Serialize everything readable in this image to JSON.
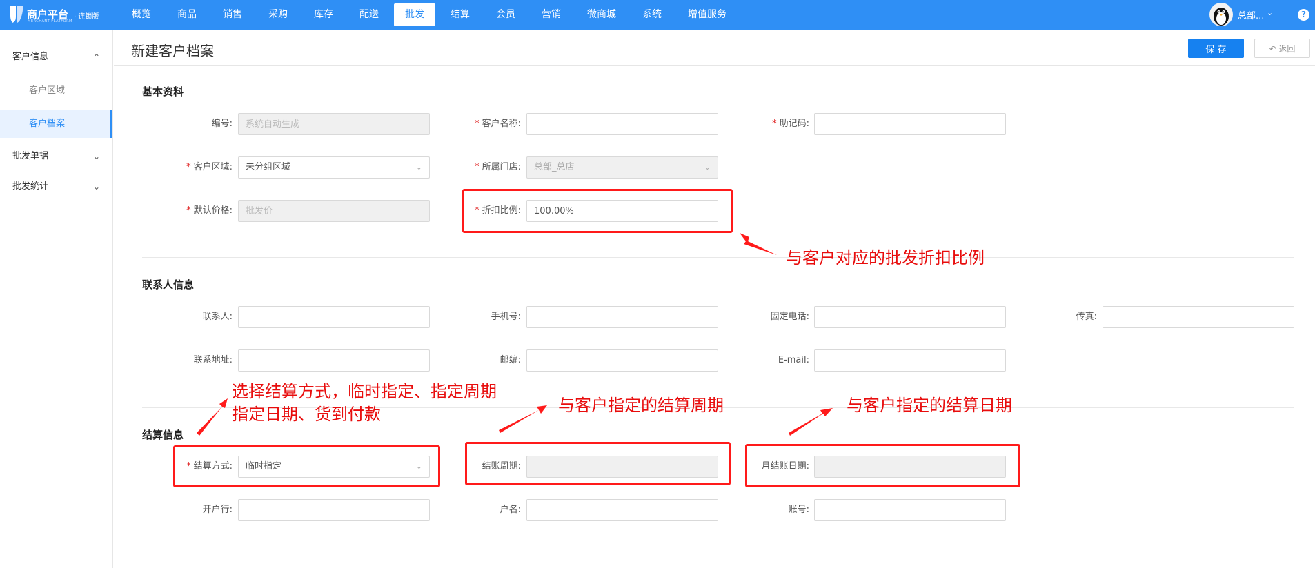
{
  "brand": {
    "title": "商户平台",
    "edition": "· 连锁版",
    "subtitle": "MERCHANT PLATFORM"
  },
  "nav": {
    "items": [
      "概览",
      "商品",
      "销售",
      "采购",
      "库存",
      "配送",
      "批发",
      "结算",
      "会员",
      "营销",
      "微商城",
      "系统",
      "增值服务"
    ],
    "active": "批发"
  },
  "user": {
    "name": "总部...",
    "help": "?"
  },
  "sidebar": {
    "groups": [
      {
        "label": "客户信息",
        "expanded": true,
        "items": [
          "客户区域",
          "客户档案"
        ]
      },
      {
        "label": "批发单据",
        "expanded": false
      },
      {
        "label": "批发统计",
        "expanded": false
      }
    ],
    "active_item": "客户档案"
  },
  "page": {
    "title": "新建客户档案",
    "save_label": "保 存",
    "back_label": "↶ 返回"
  },
  "sections": {
    "basic": {
      "title": "基本资料",
      "code": {
        "label": "编号:",
        "placeholder": "系统自动生成"
      },
      "name": {
        "label": "客户名称:",
        "value": ""
      },
      "mnemonic": {
        "label": "助记码:",
        "value": ""
      },
      "region": {
        "label": "客户区域:",
        "value": "未分组区域"
      },
      "store": {
        "label": "所属门店:",
        "value": "总部_总店"
      },
      "price": {
        "label": "默认价格:",
        "placeholder": "批发价"
      },
      "discount": {
        "label": "折扣比例:",
        "value": "100.00%"
      }
    },
    "contact": {
      "title": "联系人信息",
      "person": {
        "label": "联系人:"
      },
      "mobile": {
        "label": "手机号:"
      },
      "phone": {
        "label": "固定电话:"
      },
      "fax": {
        "label": "传真:"
      },
      "address": {
        "label": "联系地址:"
      },
      "postcode": {
        "label": "邮编:"
      },
      "email": {
        "label": "E-mail:"
      }
    },
    "settlement": {
      "title": "结算信息",
      "method": {
        "label": "结算方式:",
        "value": "临时指定"
      },
      "cycle": {
        "label": "结账周期:",
        "value": ""
      },
      "day": {
        "label": "月结账日期:",
        "value": ""
      },
      "bank": {
        "label": "开户行:"
      },
      "account_name": {
        "label": "户名:"
      },
      "account_no": {
        "label": "账号:"
      }
    }
  },
  "annotations": {
    "discount_note": "与客户对应的批发折扣比例",
    "method_note_1": "选择结算方式，临时指定、指定周期",
    "method_note_2": "指定日期、货到付款",
    "cycle_note": "与客户指定的结算周期",
    "day_note": "与客户指定的结算日期",
    "color": "#ff1a1a"
  },
  "colors": {
    "primary": "#2f8ff5",
    "save": "#1681f0",
    "required": "#e02020"
  }
}
